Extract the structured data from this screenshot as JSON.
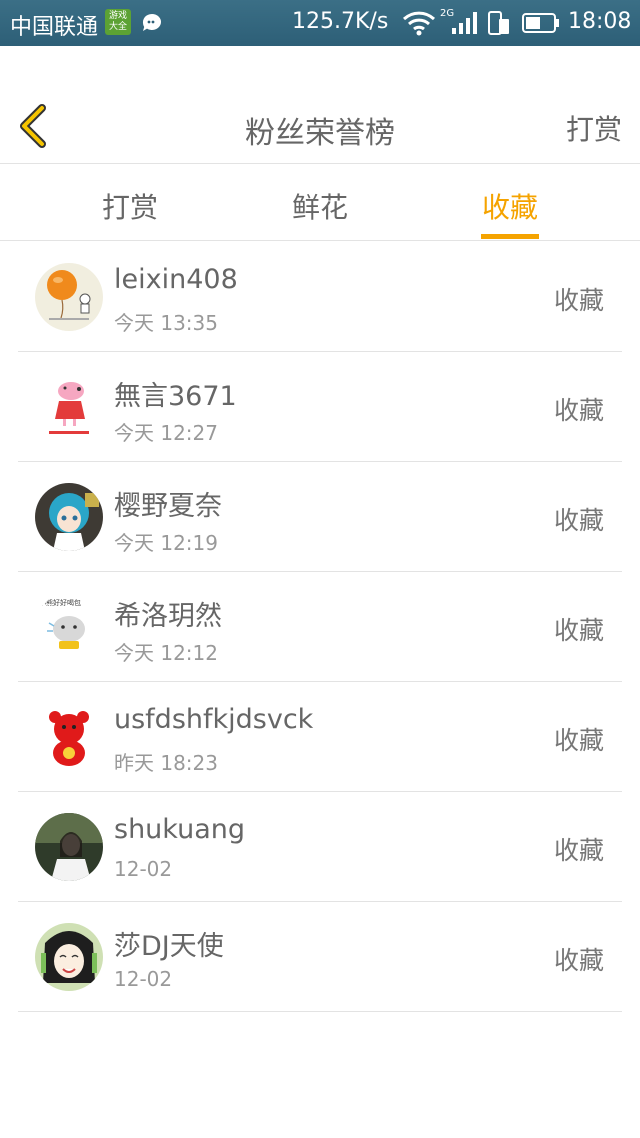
{
  "status_bar": {
    "carrier": "中国联通",
    "badge": "游戏大全",
    "speed": "125.7K/s",
    "network": "2G",
    "time": "18:08"
  },
  "header": {
    "title": "粉丝荣誉榜",
    "action": "打赏"
  },
  "tabs": [
    {
      "label": "打赏",
      "active": false
    },
    {
      "label": "鲜花",
      "active": false
    },
    {
      "label": "收藏",
      "active": true
    }
  ],
  "colors": {
    "accent": "#f5a300",
    "statusbar": "#2d5f77"
  },
  "list": [
    {
      "name": "leixin408",
      "time": "今天 13:35",
      "action": "收藏",
      "avatar": "orange-balloon-avatar"
    },
    {
      "name": "無言3671",
      "time": "今天 12:27",
      "action": "收藏",
      "avatar": "peppa-pig-avatar"
    },
    {
      "name": "樱野夏奈",
      "time": "今天 12:19",
      "action": "收藏",
      "avatar": "anime-girl-avatar"
    },
    {
      "name": "希洛玥然",
      "time": "今天 12:12",
      "action": "收藏",
      "avatar": "cartoon-cat-avatar"
    },
    {
      "name": "usfdshfkjdsvck",
      "time": "昨天 18:23",
      "action": "收藏",
      "avatar": "red-bear-avatar"
    },
    {
      "name": "shukuang",
      "time": "12-02",
      "action": "收藏",
      "avatar": "photo-girl-avatar"
    },
    {
      "name": "莎DJ天使",
      "time": "12-02",
      "action": "收藏",
      "avatar": "anime-face-avatar"
    }
  ]
}
